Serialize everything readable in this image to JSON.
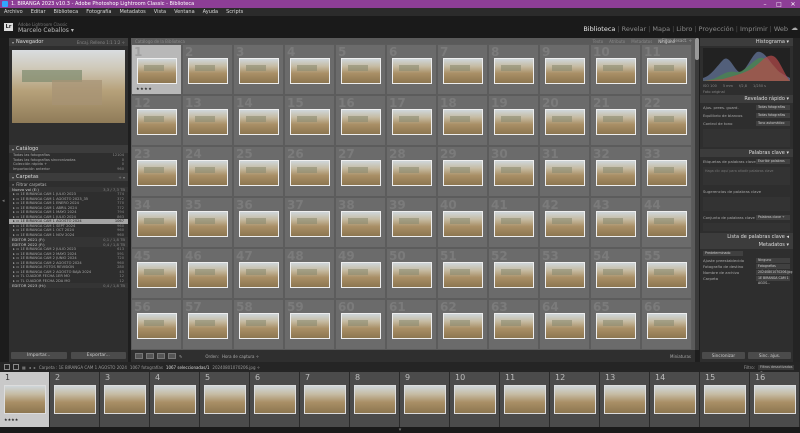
{
  "window": {
    "title": "1. BIRANGA 2023 v10.3 - Adobe Photoshop Lightroom Classic - Biblioteca",
    "controls": [
      "–",
      "□",
      "✕"
    ]
  },
  "menu": [
    "Archivo",
    "Editar",
    "Biblioteca",
    "Fotografía",
    "Metadatos",
    "Vista",
    "Ventana",
    "Ayuda",
    "Scripts"
  ],
  "identity": {
    "logo": "Lr",
    "line1": "Adobe Lightroom Classic",
    "user": "Marcelo Ceballos"
  },
  "modules": [
    {
      "label": "Biblioteca",
      "active": true
    },
    {
      "label": "Revelar"
    },
    {
      "label": "Mapa"
    },
    {
      "label": "Libro"
    },
    {
      "label": "Proyección"
    },
    {
      "label": "Imprimir"
    },
    {
      "label": "Web"
    }
  ],
  "left_panel": {
    "navigator": {
      "title": "Navegador",
      "opts": "Encaj.  Relleno  1:1  1:2 ÷"
    },
    "catalog": {
      "title": "Catálogo",
      "rows": [
        {
          "label": "Todas las fotografías",
          "count": "12104"
        },
        {
          "label": "Todas las fotografías sincronizadas",
          "count": "0"
        },
        {
          "label": "Colección rápida  +",
          "count": "0"
        },
        {
          "label": "Importación anterior",
          "count": "960"
        }
      ]
    },
    "collections": {
      "title": "Carpetas",
      "filter": "Filtrar carpetas",
      "volume": {
        "label": "Nuevo vol (E:)",
        "count": "3,3 / 7,3 TB"
      },
      "rows": [
        {
          "label": "1E BIRANGA CAM 1 JULIO 2023",
          "count": "774"
        },
        {
          "label": "1E BIRANGA CAM 1 AGOSTO 2023_35",
          "count": "372"
        },
        {
          "label": "1E BIRANGA CAM 1 ENERO 2024",
          "count": "770"
        },
        {
          "label": "1E BIRANGA CAM 1 ABRIL 2024",
          "count": "772"
        },
        {
          "label": "1E BIRANGA CAM 1 MAYO 2024",
          "count": "794"
        },
        {
          "label": "1E BIRANGA CAM 1 JULIO 2024",
          "count": "863"
        },
        {
          "label": "1E BIRANGA CAM 1 AGOSTO 2024",
          "count": "1067",
          "selected": true
        },
        {
          "label": "1E BIRANGA CAM 1 SEPT 2024",
          "count": "960"
        },
        {
          "label": "1E BIRANGA CAM 1 OCT 2024",
          "count": "960"
        },
        {
          "label": "1E BIRANGA CAM 1 NOV 2024",
          "count": "960"
        }
      ],
      "section2": {
        "label": "EDITOR 2021 (F:)",
        "count": "0,1 / 1,8 TB"
      },
      "section3": {
        "label": "EDITOR 2022 (F:)",
        "count": "0,4 / 1,8 TB"
      },
      "rows2": [
        {
          "label": "1E BIRANGA CAM 2 JULIO 2023",
          "count": "613"
        },
        {
          "label": "1E BIRANGA CAM 2 MAYO 2024",
          "count": "591"
        },
        {
          "label": "1E BIRANGA CAM 2 JUNIO 2024",
          "count": "720"
        },
        {
          "label": "1E BIRANGA CAM 2 AGOSTO 2024",
          "count": "960"
        },
        {
          "label": "1E BIRANGA FOTOS REVISIÓN",
          "count": "280"
        },
        {
          "label": "1E BIRANGA CAM 2 AGOSTO BAJA  2024",
          "count": "45"
        },
        {
          "label": "7L CUADOR FECHA 1ER MO",
          "count": "12"
        },
        {
          "label": "7L CUADOR FECHA 2DA MO",
          "count": "12"
        }
      ],
      "section4": {
        "label": "EDITOR 2023 (H:)",
        "count": "0,4 / 1,8 TB"
      }
    },
    "buttons": {
      "import": "Importar...",
      "export": "Exportar..."
    }
  },
  "grid": {
    "breadcrumb": "Catálogo de la Biblioteca",
    "filters": [
      {
        "label": "Texto"
      },
      {
        "label": "Atributo"
      },
      {
        "label": "Metadatos"
      },
      {
        "label": "Ninguno",
        "on": true
      }
    ],
    "custom": "Filtro desact. ÷",
    "stars_first": "★★★★",
    "first_number": 1,
    "cell_count": 66
  },
  "toolbar": {
    "sort_label": "Orden:",
    "sort_value": "Hora de captura ÷",
    "miniatures": "Miniaturas"
  },
  "right_panel": {
    "histogram": {
      "title": "Histograma"
    },
    "hist_info": [
      "ISO 100",
      "5 mm",
      "f/2,8",
      "1/250 s"
    ],
    "photo_label": "Foto original",
    "quick_develop": {
      "title": "Revelado rápido",
      "rows": [
        {
          "label": "Ajus. prees. guard.",
          "value": "Todas fotografías"
        },
        {
          "label": "Equilibrio de blancos",
          "value": "Todas fotografías"
        },
        {
          "label": "Control de tono",
          "value": "Tono automático"
        }
      ]
    },
    "keywords": {
      "title": "Palabras clave",
      "label": "Etiquetas de palabras clave",
      "value": "Escribir palabras"
    },
    "keyword_hint": "Haga clic aquí para añadir palabras clave",
    "suggestions": "Sugerencias de palabras clave",
    "keyword_set": {
      "label": "Conjunto de palabras clave",
      "value": "Palabras clave ÷"
    },
    "keyword_list": {
      "title": "Lista de palabras clave"
    },
    "metadata": {
      "title": "Metadatos",
      "preset": "Predeterminado",
      "rows": [
        {
          "label": "Ajuste preestablecido",
          "value": "Ninguno"
        },
        {
          "label": "Fotografía de destino",
          "value": "Fotografías seleccionadas"
        },
        {
          "label": "Nombre de archivo",
          "value": "20240801070206.jpg"
        },
        {
          "label": "Carpeta",
          "value": "1E BIRANGA CAM 1 AGOS..."
        }
      ]
    },
    "buttons": {
      "sync": "Sincronizar",
      "sync_settings": "Sinc. ajus."
    }
  },
  "filmstrip_bar": {
    "display": "1 2",
    "path": "Carpeta : 1E BIRANGA CAM 1 AGOSTO 2024",
    "count": "1067 fotografías",
    "selected": "1067 seleccionadas/1",
    "file": "20240801070206.jpg ÷",
    "filter_label": "Filtro:",
    "filter_value": "Filtros desactivados ÷"
  },
  "filmstrip": {
    "numbers": [
      1,
      2,
      3,
      4,
      5,
      6,
      7,
      8,
      9,
      10,
      11,
      12,
      13,
      14,
      15,
      16
    ],
    "stars_first": "★★★★"
  }
}
